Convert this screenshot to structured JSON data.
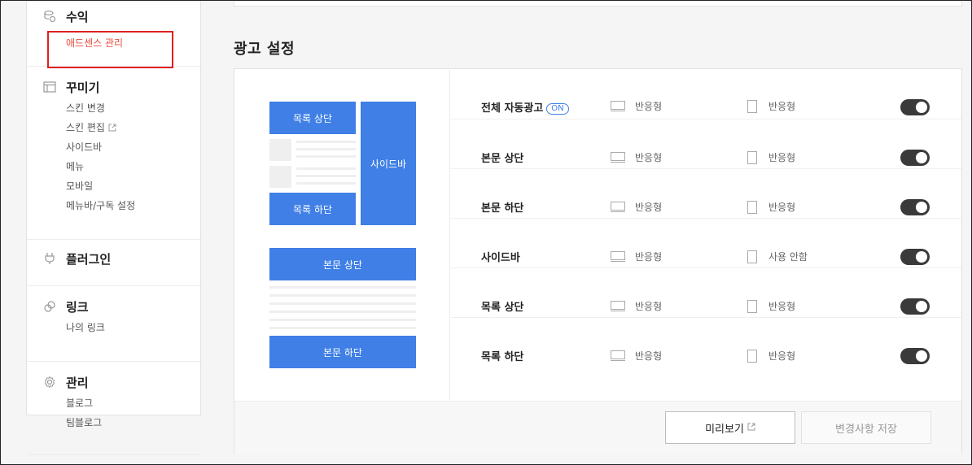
{
  "sidebar": {
    "sections": [
      {
        "title": "수익",
        "icon": "revenue-icon",
        "items": [
          "애드센스 관리"
        ]
      },
      {
        "title": "꾸미기",
        "icon": "layout-icon",
        "items": [
          "스킨 변경",
          "스킨 편집",
          "사이드바",
          "메뉴",
          "모바일",
          "메뉴바/구독 설정"
        ]
      },
      {
        "title": "플러그인",
        "icon": "plug-icon",
        "items": []
      },
      {
        "title": "링크",
        "icon": "link-icon",
        "items": [
          "나의 링크"
        ]
      },
      {
        "title": "관리",
        "icon": "gear-icon",
        "items": [
          "블로그",
          "팀블로그"
        ]
      }
    ],
    "active_item": "애드센스 관리"
  },
  "main": {
    "heading": "광고 설정",
    "preview": {
      "list_top": "목록 상단",
      "list_bottom": "목록 하단",
      "sidebar": "사이드바",
      "body_top": "본문 상단",
      "body_bottom": "본문 하단"
    },
    "on_badge": "ON",
    "rows": [
      {
        "label": "전체 자동광고",
        "pc": "반응형",
        "mobile": "반응형",
        "enabled": true
      },
      {
        "label": "본문 상단",
        "pc": "반응형",
        "mobile": "반응형",
        "enabled": true
      },
      {
        "label": "본문 하단",
        "pc": "반응형",
        "mobile": "반응형",
        "enabled": true
      },
      {
        "label": "사이드바",
        "pc": "반응형",
        "mobile": "사용 안함",
        "enabled": true
      },
      {
        "label": "목록 상단",
        "pc": "반응형",
        "mobile": "반응형",
        "enabled": true
      },
      {
        "label": "목록 하단",
        "pc": "반응형",
        "mobile": "반응형",
        "enabled": true
      }
    ],
    "buttons": {
      "preview": "미리보기",
      "save": "변경사항 저장"
    }
  },
  "colors": {
    "accent": "#3f7fe6",
    "active_link": "#e94a3f",
    "highlight_box": "#e02020",
    "toggle_on": "#3a3a3a"
  }
}
